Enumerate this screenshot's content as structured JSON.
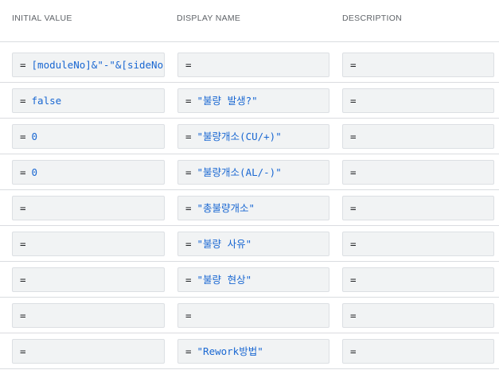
{
  "table": {
    "headers": {
      "initial_value": "INITIAL VALUE",
      "display_name": "DISPLAY NAME",
      "description": "DESCRIPTION"
    },
    "rows": [
      {
        "initial": {
          "eq": "=",
          "value": ""
        },
        "display": {
          "eq": "=",
          "value": ""
        },
        "description": {
          "eq": "=",
          "value": ""
        }
      },
      {
        "initial": {
          "eq": "=",
          "value": "[moduleNo]&\"-\"&[sideNo]"
        },
        "display": {
          "eq": "=",
          "value": ""
        },
        "description": {
          "eq": "=",
          "value": ""
        }
      },
      {
        "initial": {
          "eq": "=",
          "value": "false"
        },
        "display": {
          "eq": "=",
          "value": "\"불량 발생?\""
        },
        "description": {
          "eq": "=",
          "value": ""
        }
      },
      {
        "initial": {
          "eq": "=",
          "value": "0"
        },
        "display": {
          "eq": "=",
          "value": "\"불량개소(CU/+)\""
        },
        "description": {
          "eq": "=",
          "value": ""
        }
      },
      {
        "initial": {
          "eq": "=",
          "value": "0"
        },
        "display": {
          "eq": "=",
          "value": "\"불량개소(AL/-)\""
        },
        "description": {
          "eq": "=",
          "value": ""
        }
      },
      {
        "initial": {
          "eq": "=",
          "value": ""
        },
        "display": {
          "eq": "=",
          "value": "\"총불량개소\""
        },
        "description": {
          "eq": "=",
          "value": ""
        }
      },
      {
        "initial": {
          "eq": "=",
          "value": ""
        },
        "display": {
          "eq": "=",
          "value": "\"불량 사유\""
        },
        "description": {
          "eq": "=",
          "value": ""
        }
      },
      {
        "initial": {
          "eq": "=",
          "value": ""
        },
        "display": {
          "eq": "=",
          "value": "\"불량 현상\""
        },
        "description": {
          "eq": "=",
          "value": ""
        }
      },
      {
        "initial": {
          "eq": "=",
          "value": ""
        },
        "display": {
          "eq": "=",
          "value": ""
        },
        "description": {
          "eq": "=",
          "value": ""
        }
      },
      {
        "initial": {
          "eq": "=",
          "value": ""
        },
        "display": {
          "eq": "=",
          "value": "\"Rework방법\""
        },
        "description": {
          "eq": "=",
          "value": ""
        }
      }
    ]
  }
}
